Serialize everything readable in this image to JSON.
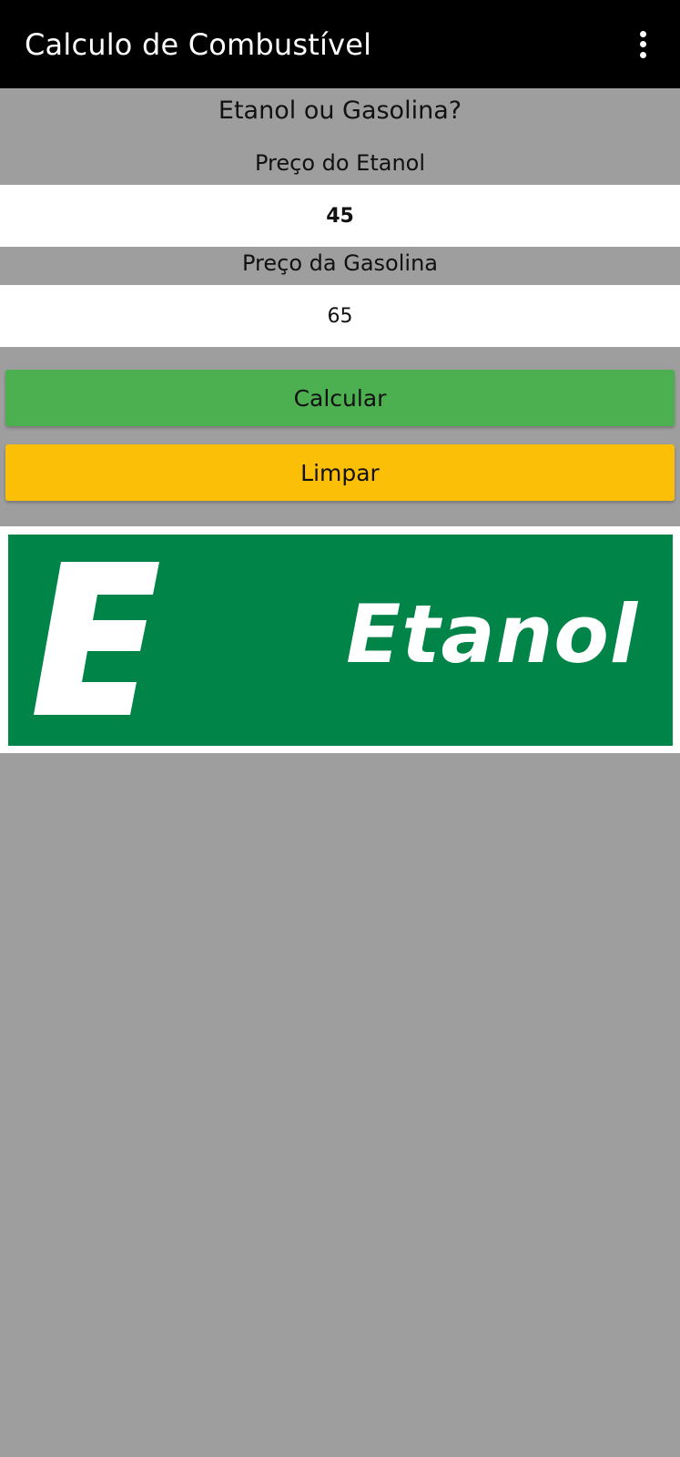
{
  "app_bar": {
    "title": "Calculo de Combustível",
    "menu_icon": "more-vert-icon"
  },
  "form": {
    "heading": "Etanol ou Gasolina?",
    "etanol_label": "Preço do Etanol",
    "etanol_value": "45",
    "gasolina_label": "Preço da Gasolina",
    "gasolina_value": "65"
  },
  "buttons": {
    "calcular_label": "Calcular",
    "limpar_label": "Limpar"
  },
  "result": {
    "fuel": "Etanol",
    "brand_color": "#018447"
  },
  "colors": {
    "background": "#9e9e9e",
    "app_bar": "#000000",
    "calcular": "#4caf50",
    "limpar": "#fcbf07"
  }
}
